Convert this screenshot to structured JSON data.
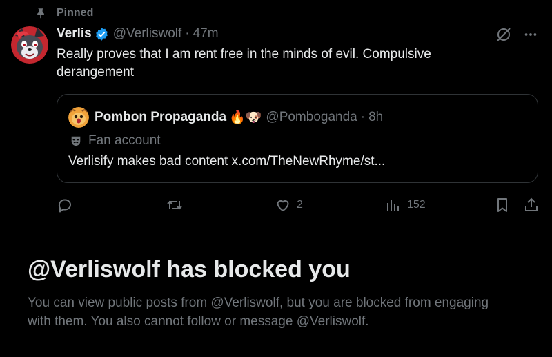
{
  "pinned": {
    "label": "Pinned",
    "icon": "pin-icon"
  },
  "tweet": {
    "author_name": "Verlis",
    "handle": "@Verliswolf",
    "separator": "·",
    "time": "47m",
    "text": "Really proves that I am rent free in the minds of evil. Compulsive derangement",
    "verified": true
  },
  "quote": {
    "author_name": "Pombon Propaganda",
    "name_emoji": "🔥🐶",
    "handle": "@Pomboganda",
    "separator": "·",
    "time": "8h",
    "label": "Fan account",
    "text": "Verlisify makes bad content x.com/TheNewRhyme/st..."
  },
  "actions": {
    "reply_count": "",
    "repost_count": "",
    "like_count": "2",
    "views_count": "152"
  },
  "blocked": {
    "title": "@Verliswolf has blocked you",
    "body": "You can view public posts from @Verliswolf, but you are blocked from engaging with them. You also cannot follow or message @Verliswolf."
  },
  "colors": {
    "background": "#000000",
    "text_primary": "#e7e9ea",
    "text_secondary": "#71767b",
    "border": "#2f3336",
    "verified_blue": "#1d9bf0"
  }
}
